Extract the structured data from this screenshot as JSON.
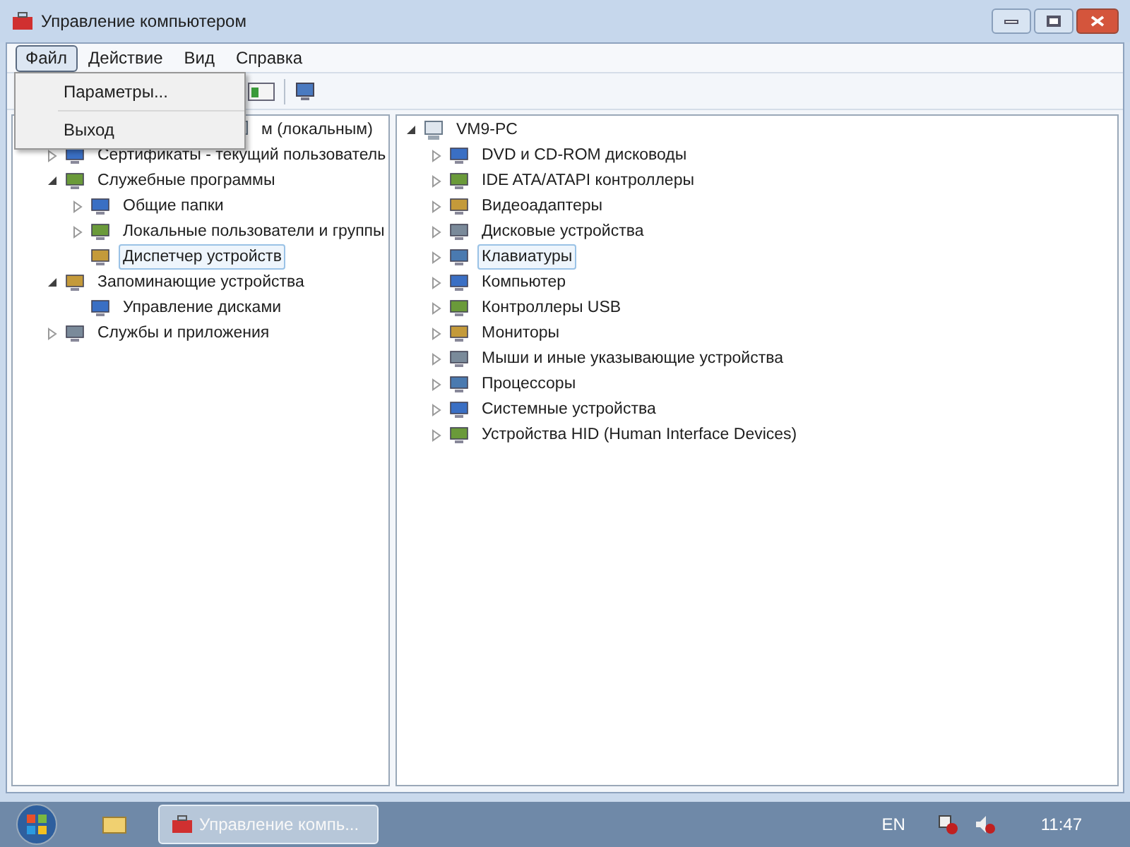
{
  "window": {
    "title": "Управление компьютером"
  },
  "menu_bar": [
    {
      "label": "Файл",
      "selected": true
    },
    {
      "label": "Действие",
      "selected": false
    },
    {
      "label": "Вид",
      "selected": false
    },
    {
      "label": "Справка",
      "selected": false
    }
  ],
  "open_menu": [
    {
      "kind": "item",
      "label": "Параметры..."
    },
    {
      "kind": "separator"
    },
    {
      "kind": "item",
      "label": "Выход"
    }
  ],
  "left_tree": [
    {
      "label": "м (локальным)",
      "selected": false,
      "children": [
        {
          "label": "Сертификаты - текущий пользователь",
          "expanded": false,
          "selected": false
        },
        {
          "label": "Служебные программы",
          "expanded": true,
          "selected": false,
          "children": [
            {
              "label": "Общие папки",
              "expanded": false,
              "selected": false
            },
            {
              "label": "Локальные пользователи и группы",
              "expanded": false,
              "selected": false
            },
            {
              "label": "Диспетчер устройств",
              "selected": true
            }
          ]
        },
        {
          "label": "Запоминающие устройства",
          "expanded": true,
          "selected": false,
          "children": [
            {
              "label": "Управление дисками",
              "selected": false
            }
          ]
        },
        {
          "label": "Службы и приложения",
          "expanded": false,
          "selected": false
        }
      ]
    }
  ],
  "right_tree": [
    {
      "label": "VM9-PC",
      "expanded": true,
      "selected": false,
      "children": [
        {
          "label": "DVD и CD-ROM дисководы",
          "expanded": false,
          "selected": false
        },
        {
          "label": "IDE ATA/ATAPI контроллеры",
          "expanded": false,
          "selected": false
        },
        {
          "label": "Видеоадаптеры",
          "expanded": false,
          "selected": false
        },
        {
          "label": "Дисковые устройства",
          "expanded": false,
          "selected": false
        },
        {
          "label": "Клавиатуры",
          "expanded": false,
          "selected": true
        },
        {
          "label": "Компьютер",
          "expanded": false,
          "selected": false
        },
        {
          "label": "Контроллеры USB",
          "expanded": false,
          "selected": false
        },
        {
          "label": "Мониторы",
          "expanded": false,
          "selected": false
        },
        {
          "label": "Мыши и иные указывающие устройства",
          "expanded": false,
          "selected": false
        },
        {
          "label": "Процессоры",
          "expanded": false,
          "selected": false
        },
        {
          "label": "Системные устройства",
          "expanded": false,
          "selected": false
        },
        {
          "label": "Устройства HID (Human Interface Devices)",
          "expanded": false,
          "selected": false
        }
      ]
    }
  ],
  "taskbar": {
    "task": "Управление компь...",
    "language": "EN",
    "clock": "11:47"
  }
}
